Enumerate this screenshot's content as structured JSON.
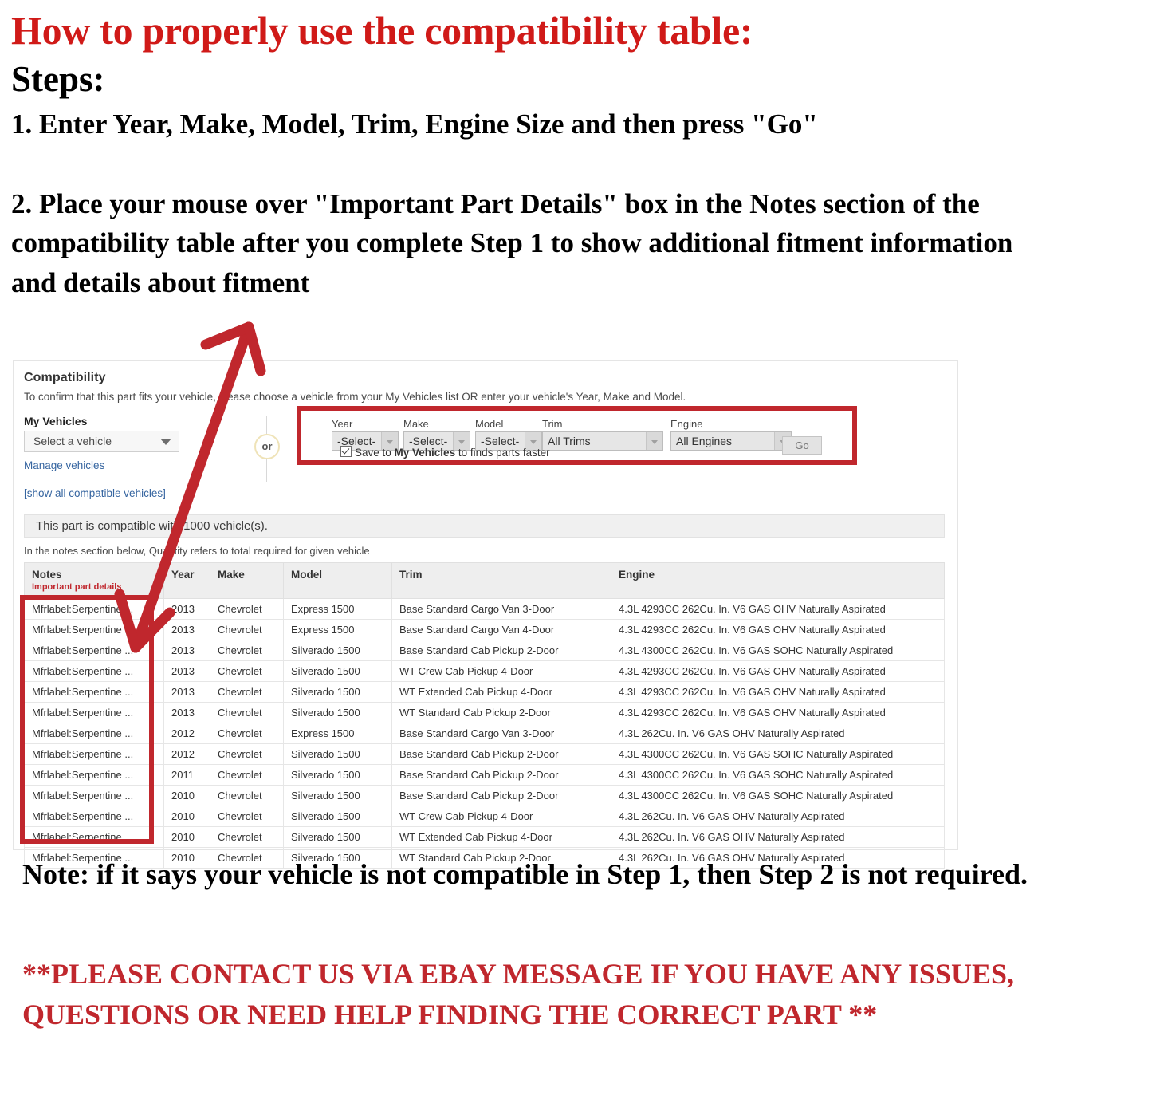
{
  "headline": {
    "title": "How to properly use the compatibility table:",
    "steps_label": "Steps:",
    "step1": "1. Enter Year, Make, Model, Trim, Engine Size and then press \"Go\"",
    "step2": "2. Place your mouse over \"Important Part Details\" box in the Notes section of the compatibility table after you complete Step 1 to show additional fitment information and details about fitment"
  },
  "compatibility": {
    "title": "Compatibility",
    "subtitle": "To confirm that this part fits your vehicle, please choose a vehicle from your My Vehicles list OR enter your vehicle's Year, Make and Model.",
    "my_vehicles_label": "My Vehicles",
    "my_vehicles_value": "Select a vehicle",
    "manage_vehicles_link": "Manage vehicles",
    "show_all_link": "[show all compatible vehicles]",
    "or_label": "or",
    "fields": [
      {
        "label": "Year",
        "value": "-Select-"
      },
      {
        "label": "Make",
        "value": "-Select-"
      },
      {
        "label": "Model",
        "value": "-Select-"
      },
      {
        "label": "Trim",
        "value": "All Trims"
      },
      {
        "label": "Engine",
        "value": "All Engines"
      }
    ],
    "go_button": "Go",
    "save_checkbox": {
      "checked": true,
      "text_before": "Save to ",
      "text_bold": "My Vehicles",
      "text_after": " to finds parts faster"
    },
    "banner": "This part is compatible with 1000 vehicle(s).",
    "notes_hint": "In the notes section below, Quantity refers to total required for given vehicle",
    "table": {
      "headers": [
        "Notes",
        "Year",
        "Make",
        "Model",
        "Trim",
        "Engine"
      ],
      "notes_subheader": "Important part details",
      "rows": [
        [
          "Mfrlabel:Serpentine ...",
          "2013",
          "Chevrolet",
          "Express 1500",
          "Base Standard Cargo Van 3-Door",
          "4.3L 4293CC 262Cu. In. V6 GAS OHV Naturally Aspirated"
        ],
        [
          "Mfrlabel:Serpentine ...",
          "2013",
          "Chevrolet",
          "Express 1500",
          "Base Standard Cargo Van 4-Door",
          "4.3L 4293CC 262Cu. In. V6 GAS OHV Naturally Aspirated"
        ],
        [
          "Mfrlabel:Serpentine ...",
          "2013",
          "Chevrolet",
          "Silverado 1500",
          "Base Standard Cab Pickup 2-Door",
          "4.3L 4300CC 262Cu. In. V6 GAS SOHC Naturally Aspirated"
        ],
        [
          "Mfrlabel:Serpentine ...",
          "2013",
          "Chevrolet",
          "Silverado 1500",
          "WT Crew Cab Pickup 4-Door",
          "4.3L 4293CC 262Cu. In. V6 GAS OHV Naturally Aspirated"
        ],
        [
          "Mfrlabel:Serpentine ...",
          "2013",
          "Chevrolet",
          "Silverado 1500",
          "WT Extended Cab Pickup 4-Door",
          "4.3L 4293CC 262Cu. In. V6 GAS OHV Naturally Aspirated"
        ],
        [
          "Mfrlabel:Serpentine ...",
          "2013",
          "Chevrolet",
          "Silverado 1500",
          "WT Standard Cab Pickup 2-Door",
          "4.3L 4293CC 262Cu. In. V6 GAS OHV Naturally Aspirated"
        ],
        [
          "Mfrlabel:Serpentine ...",
          "2012",
          "Chevrolet",
          "Express 1500",
          "Base Standard Cargo Van 3-Door",
          "4.3L 262Cu. In. V6 GAS OHV Naturally Aspirated"
        ],
        [
          "Mfrlabel:Serpentine ...",
          "2012",
          "Chevrolet",
          "Silverado 1500",
          "Base Standard Cab Pickup 2-Door",
          "4.3L 4300CC 262Cu. In. V6 GAS SOHC Naturally Aspirated"
        ],
        [
          "Mfrlabel:Serpentine ...",
          "2011",
          "Chevrolet",
          "Silverado 1500",
          "Base Standard Cab Pickup 2-Door",
          "4.3L 4300CC 262Cu. In. V6 GAS SOHC Naturally Aspirated"
        ],
        [
          "Mfrlabel:Serpentine ...",
          "2010",
          "Chevrolet",
          "Silverado 1500",
          "Base Standard Cab Pickup 2-Door",
          "4.3L 4300CC 262Cu. In. V6 GAS SOHC Naturally Aspirated"
        ],
        [
          "Mfrlabel:Serpentine ...",
          "2010",
          "Chevrolet",
          "Silverado 1500",
          "WT Crew Cab Pickup 4-Door",
          "4.3L 262Cu. In. V6 GAS OHV Naturally Aspirated"
        ],
        [
          "Mfrlabel:Serpentine ...",
          "2010",
          "Chevrolet",
          "Silverado 1500",
          "WT Extended Cab Pickup 4-Door",
          "4.3L 262Cu. In. V6 GAS OHV Naturally Aspirated"
        ],
        [
          "Mfrlabel:Serpentine ...",
          "2010",
          "Chevrolet",
          "Silverado 1500",
          "WT Standard Cab Pickup 2-Door",
          "4.3L 262Cu. In. V6 GAS OHV Naturally Aspirated"
        ]
      ]
    }
  },
  "footer": {
    "note": "Note: if it says your vehicle is not compatible in Step 1, then Step 2 is not required.",
    "contact": "**PLEASE CONTACT US VIA EBAY MESSAGE IF YOU HAVE ANY ISSUES, QUESTIONS OR NEED HELP FINDING THE CORRECT PART **"
  },
  "colors": {
    "accent_red": "#c0272d",
    "headline_red": "#d01a18",
    "link_blue": "#3665a0"
  }
}
